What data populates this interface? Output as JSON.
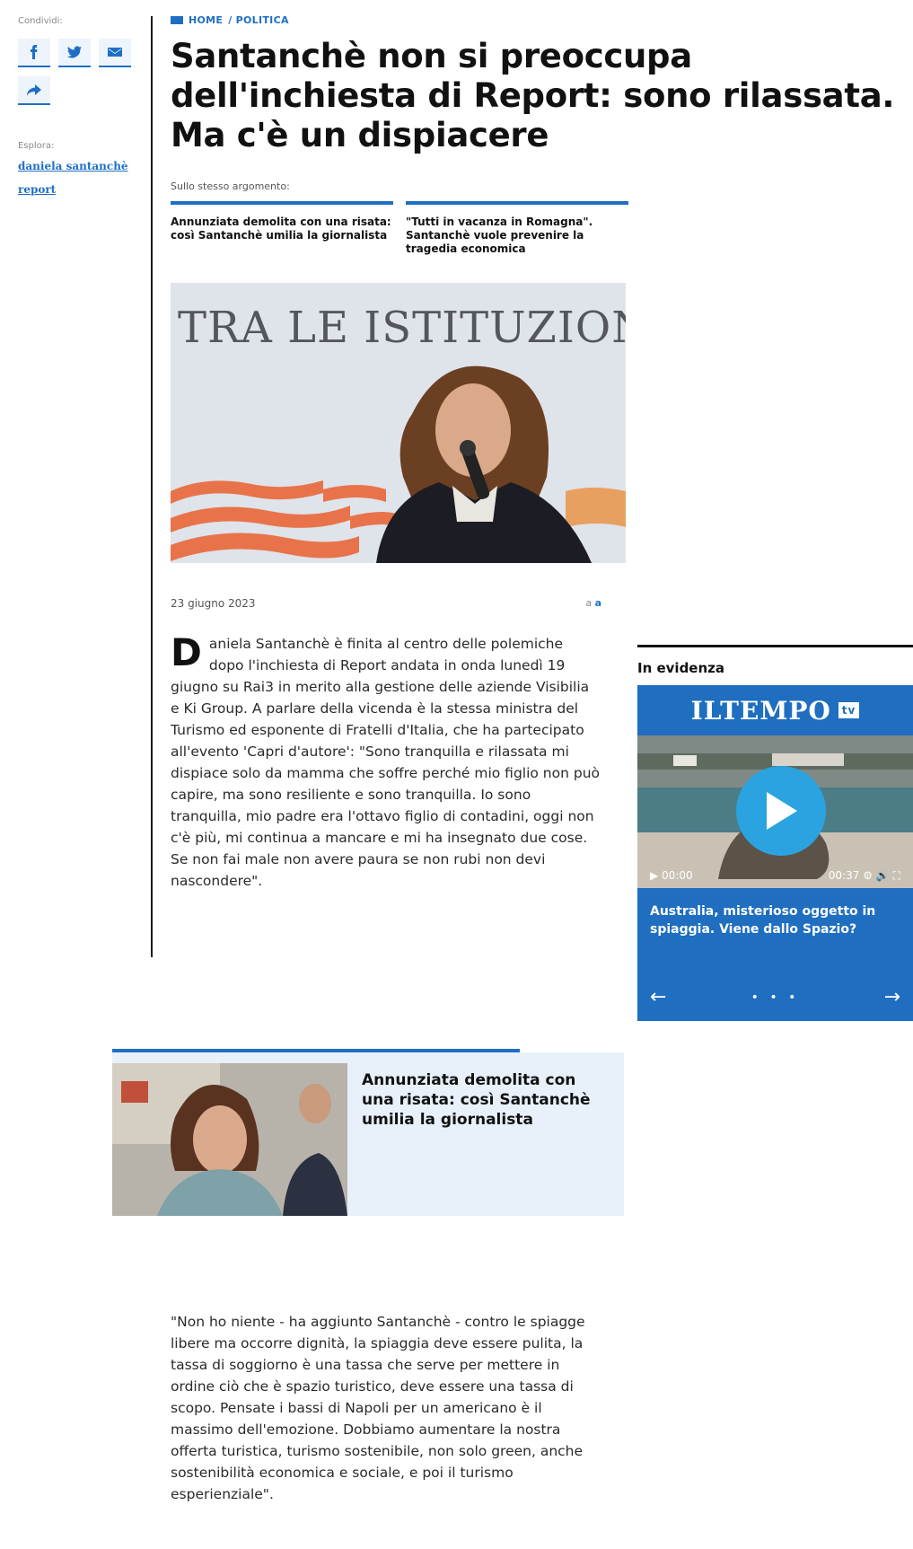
{
  "share": {
    "label": "Condividi:",
    "buttons": [
      "facebook-icon",
      "twitter-icon",
      "mail-icon",
      "share-icon"
    ]
  },
  "explore": {
    "label": "Esplora:",
    "links": [
      "daniela santanchè",
      "report"
    ]
  },
  "breadcrumb": {
    "home": "HOME",
    "section": "/ POLITICA"
  },
  "headline": "Santanchè non si preoccupa dell'inchiesta di Report: sono rilassata. Ma c'è un dispiacere",
  "related": {
    "label": "Sullo stesso argomento:",
    "items": [
      "Annunziata demolita con una risata: così Santanchè umilia la giornalista",
      "\"Tutti in vacanza in Romagna\". Santanchè vuole prevenire la tragedia economica"
    ]
  },
  "hero": {
    "sign_text": "TRA LE ISTITUZIONI,"
  },
  "meta": {
    "date": "23 giugno 2023",
    "font_small": "a",
    "font_large": "a"
  },
  "article": {
    "dropcap": "D",
    "paragraph1": "aniela Santanchè è finita al centro delle polemiche dopo l'inchiesta di Report andata in onda lunedì 19 giugno su Rai3 in merito alla gestione delle aziende Visibilia e Ki Group. A parlare della vicenda è la stessa ministra del Turismo ed esponente di Fratelli d'Italia, che ha partecipato all'evento 'Capri d'autore': \"Sono tranquilla e rilassata mi dispiace solo da mamma che soffre perché mio figlio non può capire, ma sono resiliente e sono tranquilla. Io sono tranquilla, mio padre era l'ottavo figlio di contadini, oggi non c'è più, mi continua a mancare e mi ha insegnato due cose. Se non fai male non avere paura se non rubi non devi nascondere\".",
    "paragraph2": "\"Non ho niente - ha aggiunto Santanchè - contro le spiagge libere ma occorre dignità, la spiaggia deve essere pulita, la tassa di soggiorno è una tassa che serve per mettere in ordine ciò che è spazio turistico, deve essere una tassa di scopo. Pensate i bassi di Napoli per un americano è il massimo dell'emozione. Dobbiamo aumentare la nostra offerta turistica, turismo sostenibile, non solo green, anche sostenibilità economica e sociale, e poi il turismo esperienziale\"."
  },
  "sidebar": {
    "title": "In evidenza",
    "brand": "ILTEMPO",
    "brand_badge": "tv",
    "video_time_current": "00:00",
    "video_time_total": "00:37",
    "caption": "Australia, misterioso oggetto in spiaggia. Viene dallo Spazio?",
    "prev": "←",
    "next": "→",
    "dots": "• • •"
  },
  "related_box": {
    "title": "Annunziata demolita con una risata: così Santanchè umilia la giornalista"
  },
  "colors": {
    "accent": "#1e6fc4",
    "card": "#1f6ec0",
    "play": "#2aa3e0",
    "related_bg": "#e8f1fa"
  }
}
